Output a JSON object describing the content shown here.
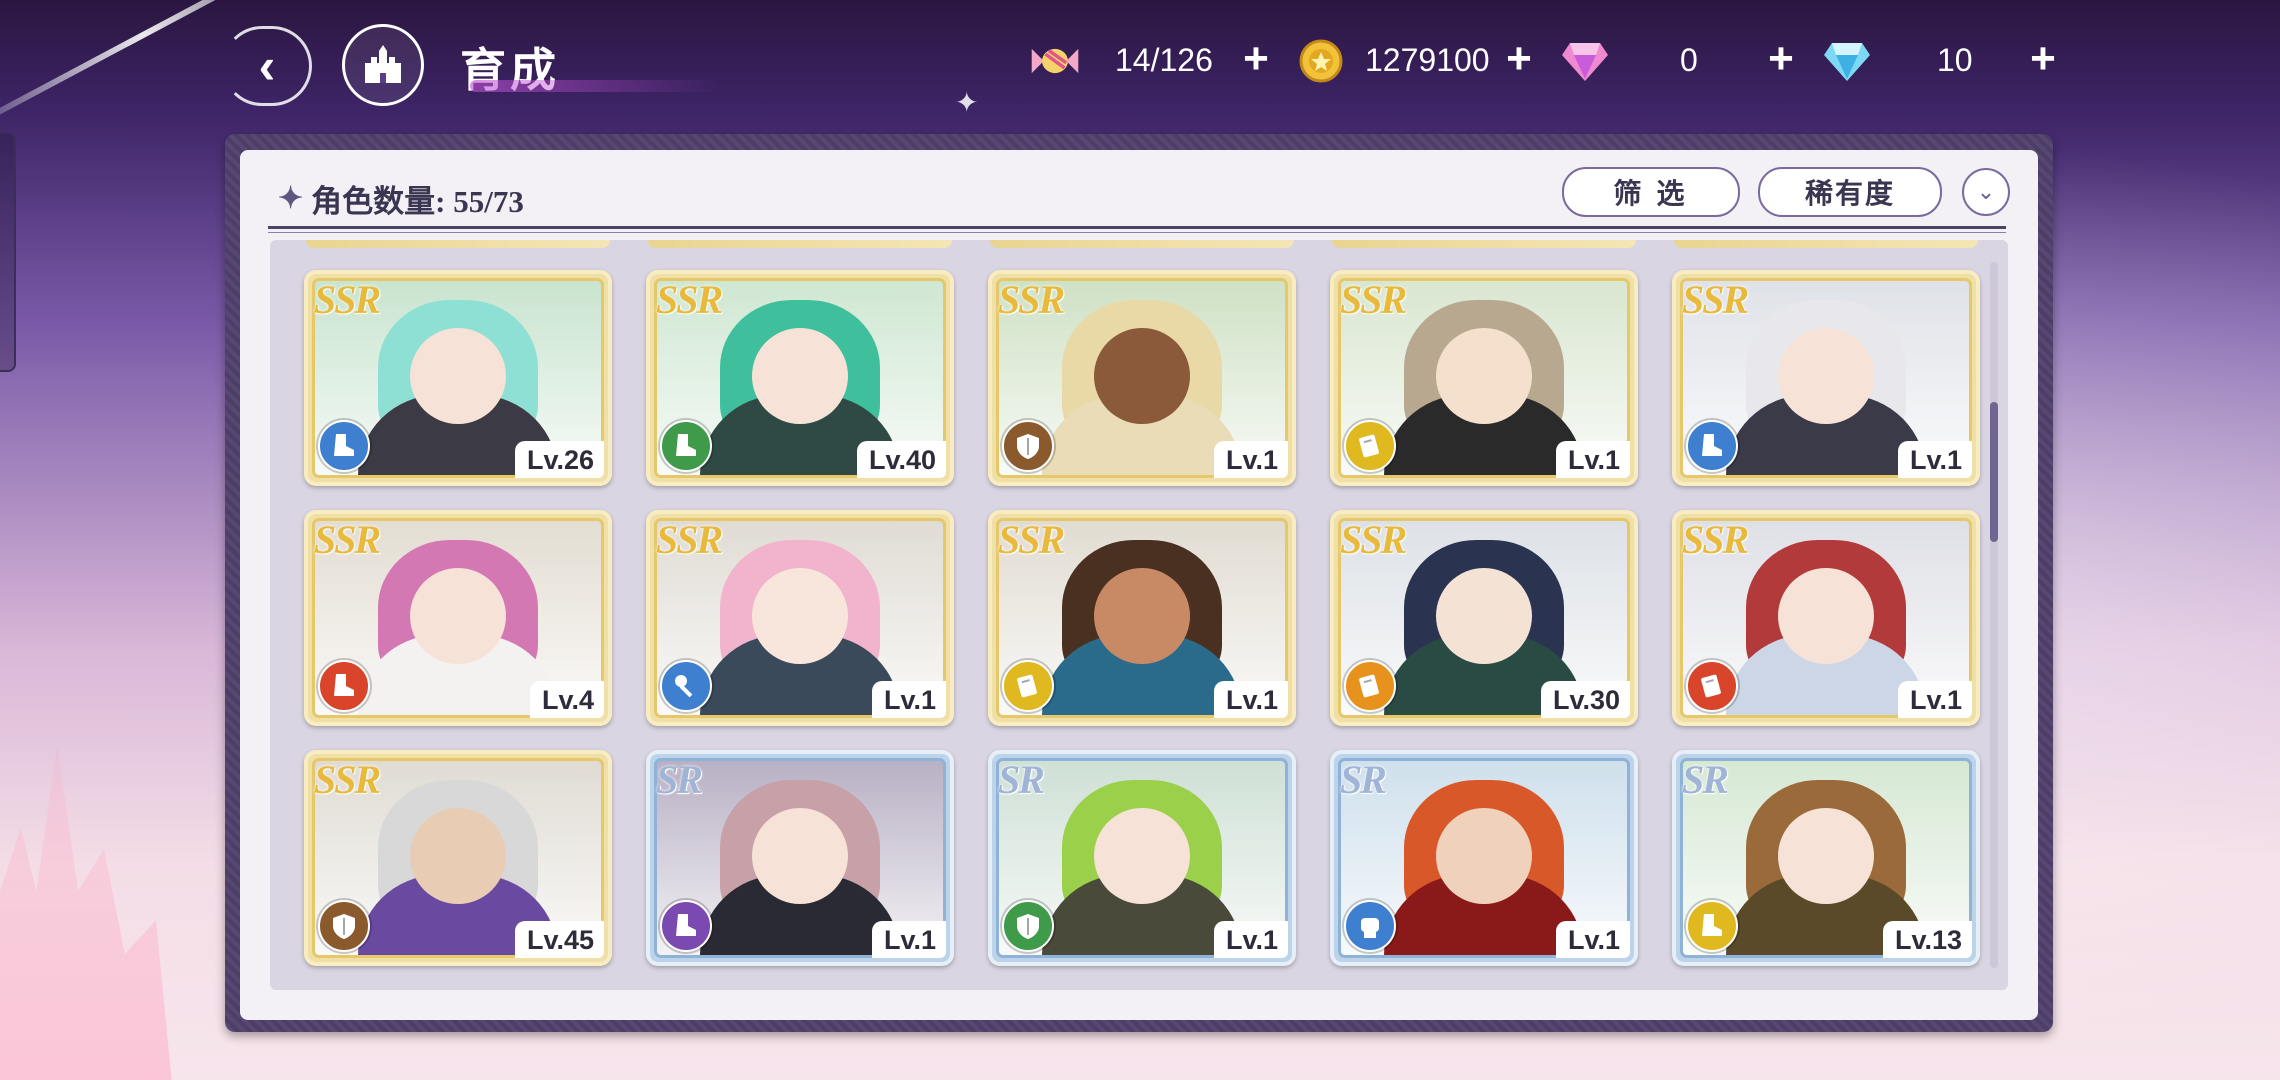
{
  "header": {
    "title": "育成",
    "resources": [
      {
        "name": "stamina",
        "icon": "candy-icon",
        "value": "14/126"
      },
      {
        "name": "gold",
        "icon": "coin-icon",
        "value": "1279100"
      },
      {
        "name": "paid-gem",
        "icon": "pink-diamond-icon",
        "value": "0"
      },
      {
        "name": "free-gem",
        "icon": "blue-diamond-icon",
        "value": "10"
      }
    ],
    "plus_label": "+"
  },
  "panel": {
    "count_label": "角色数量: 55/73",
    "filter_label": "筛 选",
    "sort_label": "稀有度"
  },
  "colors": {
    "ssr_gold": "#e8b93a",
    "sr_blue": "#9fb4d6",
    "attr_blue": "#3f7fd0",
    "attr_green": "#3f9a4a",
    "attr_brown": "#8a5a2c",
    "attr_yellow": "#e0b820",
    "attr_red": "#d8452a",
    "attr_orange": "#e8921e",
    "attr_purple": "#7a4ab0"
  },
  "cards": [
    {
      "rarity": "SSR",
      "level": "Lv.26",
      "attr": "blue-boot-icon",
      "attr_color": "#3f7fd0",
      "bg": "#c9e4cf",
      "hair": "#8fe0d4",
      "skin": "#f6e2d6",
      "outfit": "#3c3a44"
    },
    {
      "rarity": "SSR",
      "level": "Lv.40",
      "attr": "green-boot-icon",
      "attr_color": "#3f9a4a",
      "bg": "#cfe7d2",
      "hair": "#3fbf9c",
      "skin": "#f6e2d6",
      "outfit": "#2f4a44"
    },
    {
      "rarity": "SSR",
      "level": "Lv.1",
      "attr": "brown-shield-icon",
      "attr_color": "#8a5a2c",
      "bg": "#cfe1c5",
      "hair": "#e8d9a6",
      "skin": "#8a5a3a",
      "outfit": "#e9dcb6"
    },
    {
      "rarity": "SSR",
      "level": "Lv.1",
      "attr": "yellow-book-icon",
      "attr_color": "#e0b820",
      "bg": "#d9e6d0",
      "hair": "#b8a890",
      "skin": "#f4e0cc",
      "outfit": "#2a2a2a"
    },
    {
      "rarity": "SSR",
      "level": "Lv.1",
      "attr": "blue-boot-icon",
      "attr_color": "#3f7fd0",
      "bg": "#dfe2e8",
      "hair": "#e8e8ec",
      "skin": "#f6e2d6",
      "outfit": "#3a3a48"
    },
    {
      "rarity": "SSR",
      "level": "Lv.4",
      "attr": "red-boot-icon",
      "attr_color": "#d8452a",
      "bg": "#e3ddd2",
      "hair": "#d478b4",
      "skin": "#f6e2d6",
      "outfit": "#f4f2f0"
    },
    {
      "rarity": "SSR",
      "level": "Lv.1",
      "attr": "blue-key-icon",
      "attr_color": "#3f7fd0",
      "bg": "#e0dcd4",
      "hair": "#f2b4cc",
      "skin": "#f8e6dc",
      "outfit": "#3a4a5a"
    },
    {
      "rarity": "SSR",
      "level": "Lv.1",
      "attr": "yellow-book-icon",
      "attr_color": "#e0b820",
      "bg": "#e1dcd2",
      "hair": "#4a3020",
      "skin": "#c88a64",
      "outfit": "#2a6a8a"
    },
    {
      "rarity": "SSR",
      "level": "Lv.30",
      "attr": "orange-book-icon",
      "attr_color": "#e8921e",
      "bg": "#dde1e6",
      "hair": "#2a3450",
      "skin": "#f4e2d4",
      "outfit": "#2a4a44"
    },
    {
      "rarity": "SSR",
      "level": "Lv.1",
      "attr": "red-book-icon",
      "attr_color": "#d8452a",
      "bg": "#dfe0e6",
      "hair": "#b23a3a",
      "skin": "#f6e2d6",
      "outfit": "#cdd6e6"
    },
    {
      "rarity": "SSR",
      "level": "Lv.45",
      "attr": "brown-shield-icon",
      "attr_color": "#8a5a2c",
      "bg": "#e0dcd4",
      "hair": "#d8d8d8",
      "skin": "#e8ccb4",
      "outfit": "#6a4aa0"
    },
    {
      "rarity": "SR",
      "level": "Lv.1",
      "attr": "purple-boot-icon",
      "attr_color": "#7a4ab0",
      "bg": "#b8b0c4",
      "hair": "#c8a0a8",
      "skin": "#f6e2d6",
      "outfit": "#2a2a34"
    },
    {
      "rarity": "SR",
      "level": "Lv.1",
      "attr": "green-shield-icon",
      "attr_color": "#3f9a4a",
      "bg": "#cfe0d6",
      "hair": "#9ad04a",
      "skin": "#f6e2d6",
      "outfit": "#4a4a3a"
    },
    {
      "rarity": "SR",
      "level": "Lv.1",
      "attr": "blue-fist-icon",
      "attr_color": "#3f7fd0",
      "bg": "#cfe0ec",
      "hair": "#d8582a",
      "skin": "#f0d2bc",
      "outfit": "#8a1a1a"
    },
    {
      "rarity": "SR",
      "level": "Lv.13",
      "attr": "yellow-boot-icon",
      "attr_color": "#e0b820",
      "bg": "#d6e8d4",
      "hair": "#9a6a3a",
      "skin": "#f6e2d6",
      "outfit": "#5a4a2a"
    }
  ]
}
